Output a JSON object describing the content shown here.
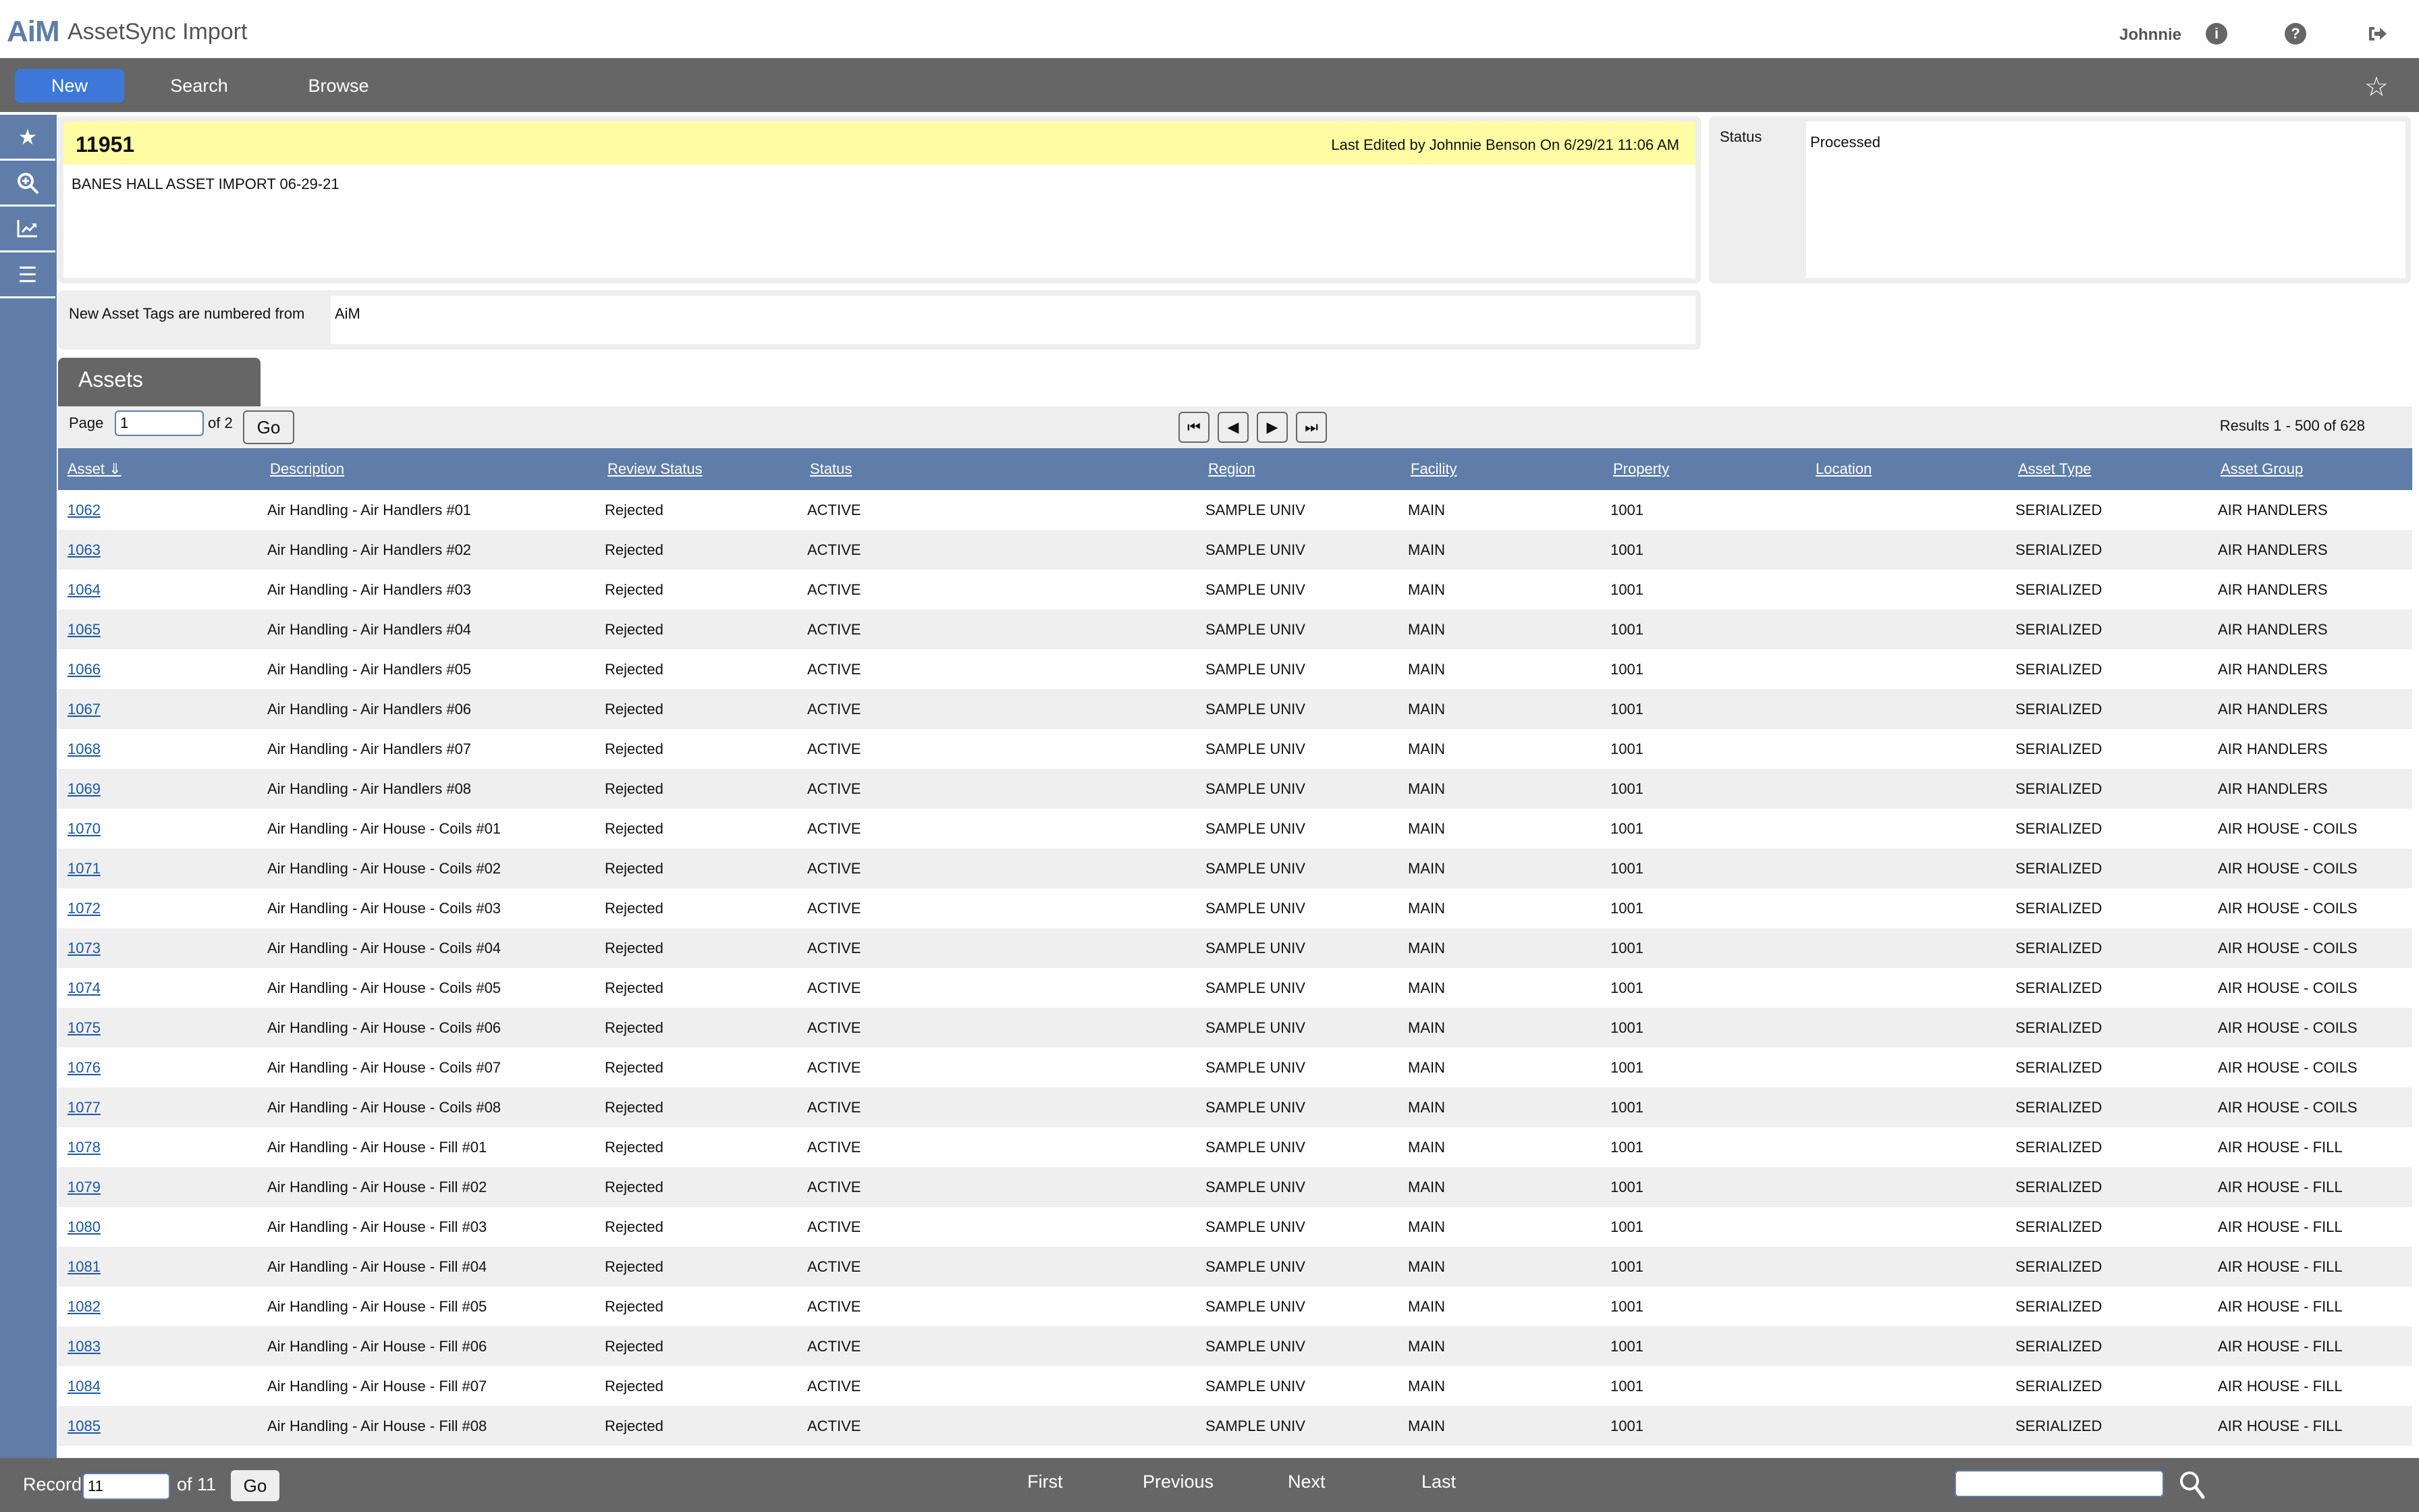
{
  "app": {
    "logo": "AiM",
    "title": "AssetSync Import",
    "user": "Johnnie",
    "icons": [
      "info-icon",
      "help-icon",
      "logout-icon"
    ]
  },
  "nav": {
    "new_label": "New",
    "search_label": "Search",
    "browse_label": "Browse",
    "favorite_icon": "star-outline-icon"
  },
  "sidebar": {
    "items": [
      {
        "icon": "star-icon",
        "glyph": "★"
      },
      {
        "icon": "zoom-in-icon",
        "glyph": "⊕"
      },
      {
        "icon": "chart-line-icon",
        "glyph": "📈"
      },
      {
        "icon": "menu-icon",
        "glyph": "☰"
      }
    ]
  },
  "record": {
    "id": "11951",
    "last_edited": "Last Edited by Johnnie Benson On 6/29/21 11:06 AM",
    "description": "BANES HALL ASSET IMPORT 06-29-21",
    "status_label": "Status",
    "status_value": "Processed",
    "tags_label": "New Asset Tags are numbered from",
    "tags_value": "AiM"
  },
  "assets": {
    "tab_label": "Assets",
    "page_label": "Page",
    "page_value": "1",
    "page_of": "of 2",
    "go_label": "Go",
    "results": "Results 1 - 500 of 628",
    "columns": [
      "Asset ⇓",
      "Description",
      "Review Status",
      "Status",
      "Region",
      "Facility",
      "Property",
      "Location",
      "Asset Type",
      "Asset Group"
    ],
    "rows": [
      [
        "1062",
        "Air Handling - Air Handlers #01",
        "Rejected",
        "ACTIVE",
        "SAMPLE UNIV",
        "MAIN",
        "1001",
        "",
        "SERIALIZED",
        "AIR HANDLERS"
      ],
      [
        "1063",
        "Air Handling - Air Handlers #02",
        "Rejected",
        "ACTIVE",
        "SAMPLE UNIV",
        "MAIN",
        "1001",
        "",
        "SERIALIZED",
        "AIR HANDLERS"
      ],
      [
        "1064",
        "Air Handling - Air Handlers #03",
        "Rejected",
        "ACTIVE",
        "SAMPLE UNIV",
        "MAIN",
        "1001",
        "",
        "SERIALIZED",
        "AIR HANDLERS"
      ],
      [
        "1065",
        "Air Handling - Air Handlers #04",
        "Rejected",
        "ACTIVE",
        "SAMPLE UNIV",
        "MAIN",
        "1001",
        "",
        "SERIALIZED",
        "AIR HANDLERS"
      ],
      [
        "1066",
        "Air Handling - Air Handlers #05",
        "Rejected",
        "ACTIVE",
        "SAMPLE UNIV",
        "MAIN",
        "1001",
        "",
        "SERIALIZED",
        "AIR HANDLERS"
      ],
      [
        "1067",
        "Air Handling - Air Handlers #06",
        "Rejected",
        "ACTIVE",
        "SAMPLE UNIV",
        "MAIN",
        "1001",
        "",
        "SERIALIZED",
        "AIR HANDLERS"
      ],
      [
        "1068",
        "Air Handling - Air Handlers #07",
        "Rejected",
        "ACTIVE",
        "SAMPLE UNIV",
        "MAIN",
        "1001",
        "",
        "SERIALIZED",
        "AIR HANDLERS"
      ],
      [
        "1069",
        "Air Handling - Air Handlers #08",
        "Rejected",
        "ACTIVE",
        "SAMPLE UNIV",
        "MAIN",
        "1001",
        "",
        "SERIALIZED",
        "AIR HANDLERS"
      ],
      [
        "1070",
        "Air Handling - Air House - Coils #01",
        "Rejected",
        "ACTIVE",
        "SAMPLE UNIV",
        "MAIN",
        "1001",
        "",
        "SERIALIZED",
        "AIR HOUSE - COILS"
      ],
      [
        "1071",
        "Air Handling - Air House - Coils #02",
        "Rejected",
        "ACTIVE",
        "SAMPLE UNIV",
        "MAIN",
        "1001",
        "",
        "SERIALIZED",
        "AIR HOUSE - COILS"
      ],
      [
        "1072",
        "Air Handling - Air House - Coils #03",
        "Rejected",
        "ACTIVE",
        "SAMPLE UNIV",
        "MAIN",
        "1001",
        "",
        "SERIALIZED",
        "AIR HOUSE - COILS"
      ],
      [
        "1073",
        "Air Handling - Air House - Coils #04",
        "Rejected",
        "ACTIVE",
        "SAMPLE UNIV",
        "MAIN",
        "1001",
        "",
        "SERIALIZED",
        "AIR HOUSE - COILS"
      ],
      [
        "1074",
        "Air Handling - Air House - Coils #05",
        "Rejected",
        "ACTIVE",
        "SAMPLE UNIV",
        "MAIN",
        "1001",
        "",
        "SERIALIZED",
        "AIR HOUSE - COILS"
      ],
      [
        "1075",
        "Air Handling - Air House - Coils #06",
        "Rejected",
        "ACTIVE",
        "SAMPLE UNIV",
        "MAIN",
        "1001",
        "",
        "SERIALIZED",
        "AIR HOUSE - COILS"
      ],
      [
        "1076",
        "Air Handling - Air House - Coils #07",
        "Rejected",
        "ACTIVE",
        "SAMPLE UNIV",
        "MAIN",
        "1001",
        "",
        "SERIALIZED",
        "AIR HOUSE - COILS"
      ],
      [
        "1077",
        "Air Handling - Air House - Coils #08",
        "Rejected",
        "ACTIVE",
        "SAMPLE UNIV",
        "MAIN",
        "1001",
        "",
        "SERIALIZED",
        "AIR HOUSE - COILS"
      ],
      [
        "1078",
        "Air Handling - Air House - Fill #01",
        "Rejected",
        "ACTIVE",
        "SAMPLE UNIV",
        "MAIN",
        "1001",
        "",
        "SERIALIZED",
        "AIR HOUSE - FILL"
      ],
      [
        "1079",
        "Air Handling - Air House - Fill #02",
        "Rejected",
        "ACTIVE",
        "SAMPLE UNIV",
        "MAIN",
        "1001",
        "",
        "SERIALIZED",
        "AIR HOUSE - FILL"
      ],
      [
        "1080",
        "Air Handling - Air House - Fill #03",
        "Rejected",
        "ACTIVE",
        "SAMPLE UNIV",
        "MAIN",
        "1001",
        "",
        "SERIALIZED",
        "AIR HOUSE - FILL"
      ],
      [
        "1081",
        "Air Handling - Air House - Fill #04",
        "Rejected",
        "ACTIVE",
        "SAMPLE UNIV",
        "MAIN",
        "1001",
        "",
        "SERIALIZED",
        "AIR HOUSE - FILL"
      ],
      [
        "1082",
        "Air Handling - Air House - Fill #05",
        "Rejected",
        "ACTIVE",
        "SAMPLE UNIV",
        "MAIN",
        "1001",
        "",
        "SERIALIZED",
        "AIR HOUSE - FILL"
      ],
      [
        "1083",
        "Air Handling - Air House - Fill #06",
        "Rejected",
        "ACTIVE",
        "SAMPLE UNIV",
        "MAIN",
        "1001",
        "",
        "SERIALIZED",
        "AIR HOUSE - FILL"
      ],
      [
        "1084",
        "Air Handling - Air House - Fill #07",
        "Rejected",
        "ACTIVE",
        "SAMPLE UNIV",
        "MAIN",
        "1001",
        "",
        "SERIALIZED",
        "AIR HOUSE - FILL"
      ],
      [
        "1085",
        "Air Handling - Air House - Fill #08",
        "Rejected",
        "ACTIVE",
        "SAMPLE UNIV",
        "MAIN",
        "1001",
        "",
        "SERIALIZED",
        "AIR HOUSE - FILL"
      ]
    ]
  },
  "footer": {
    "record_label": "Record",
    "record_value": "11",
    "record_of": "of 11",
    "go_label": "Go",
    "first": "First",
    "previous": "Previous",
    "next": "Next",
    "last": "Last",
    "search_value": ""
  },
  "colors": {
    "brand": "#5f7da8",
    "navbar": "#666666",
    "active_button": "#3d78d8",
    "highlight": "#fffca4",
    "link": "#1a56a8"
  }
}
